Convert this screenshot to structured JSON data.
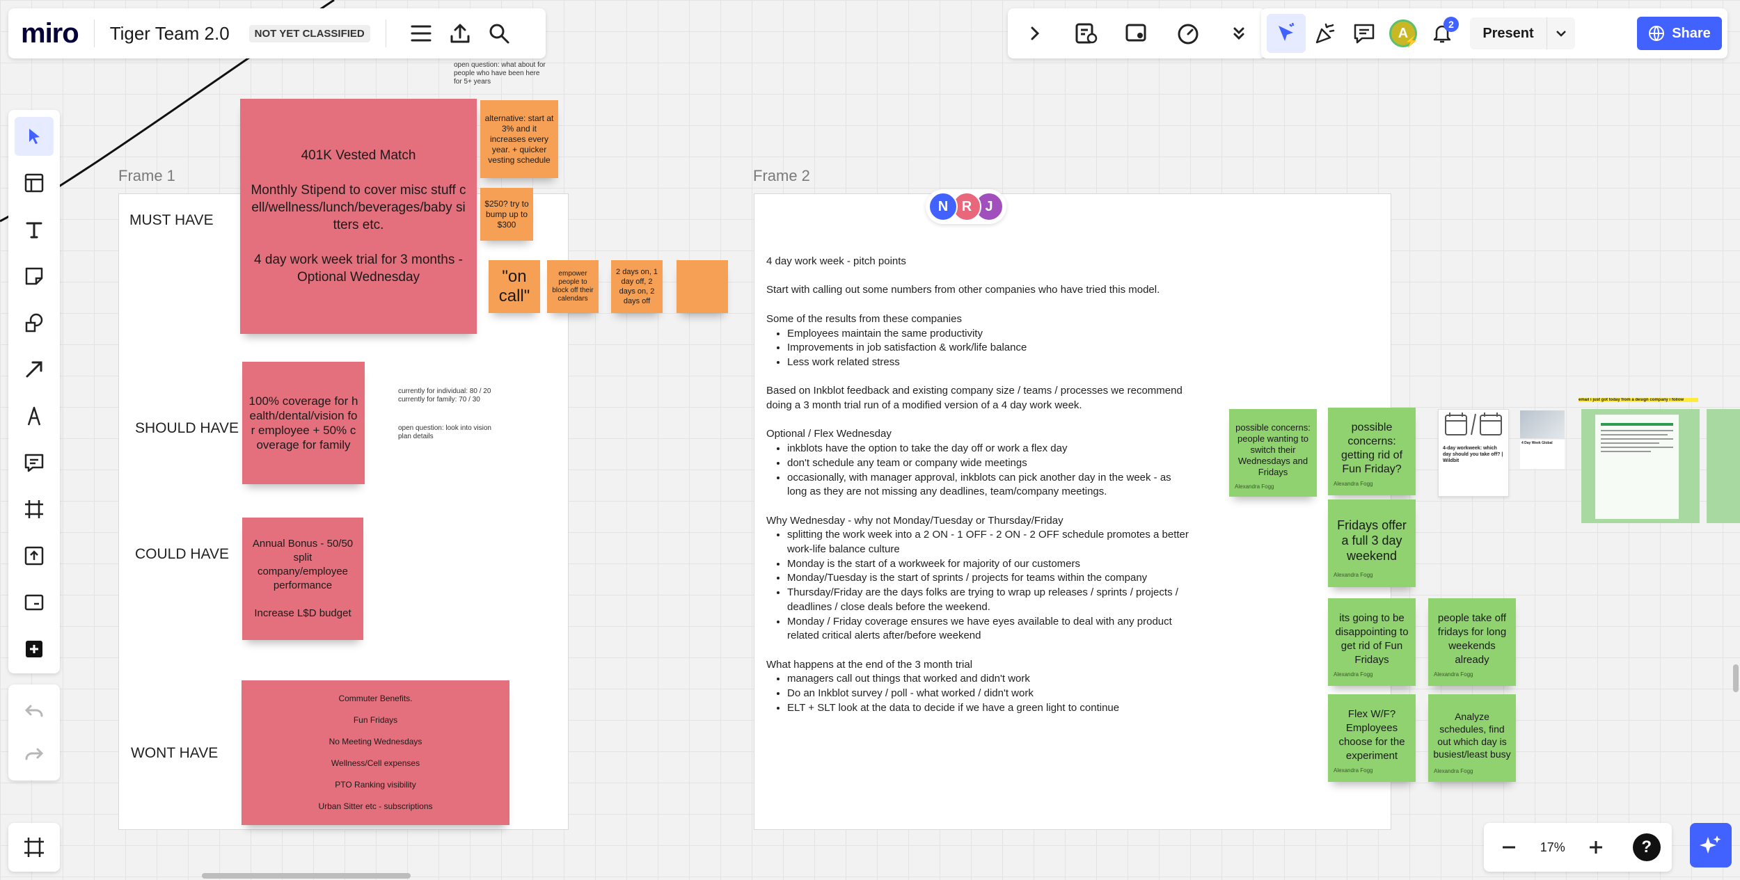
{
  "topbar": {
    "logo": "miro",
    "board_title": "Tiger Team 2.0",
    "classification": "NOT YET CLASSIFIED"
  },
  "top_right": {
    "avatar_initial": "A",
    "notification_count": "2",
    "present_label": "Present",
    "share_label": "Share"
  },
  "colors": {
    "accent": "#4262ff",
    "sticky_pink": "#e5707d",
    "sticky_orange": "#f6a055",
    "sticky_green": "#8fd26f"
  },
  "frame1": {
    "label": "Frame 1",
    "sections": {
      "must": "MUST HAVE",
      "should": "SHOULD HAVE",
      "could": "COULD HAVE",
      "wont": "WONT HAVE"
    },
    "must_sticky": [
      "401K Vested Match",
      "Monthly Stipend to cover misc stuff cell/wellness/lunch/beverages/baby sitters etc.",
      "4 day work week trial for 3 months - Optional Wednesday"
    ],
    "should_sticky": "100% coverage for health/dental/vision for employee + 50% coverage for family",
    "should_notes": {
      "individual": "currently for individual: 80 / 20",
      "family": "currently for family: 70 / 30",
      "question": "open question: look into vision plan details"
    },
    "could_sticky": [
      "Annual Bonus - 50/50 split company/employee performance",
      "Increase L$D budget"
    ],
    "wont_sticky": [
      "Commuter Benefits.",
      "Fun Fridays",
      "No Meeting Wednesdays",
      "Wellness/Cell expenses",
      "PTO Ranking visibility",
      "Urban Sitter etc - subscriptions"
    ],
    "top_note": "open question: what about for people who have been here for 5+ years",
    "orange_stickies": {
      "alternative": "alternative: start at 3% and it increases every year. + quicker vesting schedule",
      "bump": "$250? try to bump up to $300",
      "on_call": "\"on call\"",
      "empower": "empower people to block off their calendars",
      "days": "2 days on, 1 day off, 2 days on, 2 days off",
      "blank": ""
    }
  },
  "frame2": {
    "label": "Frame 2",
    "collaborators": [
      "N",
      "R",
      "J"
    ],
    "doc": {
      "title": "4 day work week - pitch points",
      "intro": "Start with calling out some numbers from other companies who have tried this model.",
      "results_heading": "Some of the results from these companies",
      "results": [
        "Employees maintain the same productivity",
        "Improvements in job satisfaction & work/life balance",
        "Less work related stress"
      ],
      "recommendation": "Based on Inkblot feedback and existing company size / teams / processes we recommend doing a 3 month trial run of a modified version of a 4 day work week.",
      "optional_heading": "Optional / Flex Wednesday",
      "optional": [
        "inkblots have the option to take the day off or work a flex day",
        "don't schedule any team or company wide meetings",
        "occasionally, with manager approval, inkblots can pick another day in the week - as long as they are not missing any deadlines, team/company meetings."
      ],
      "why_heading": "Why Wednesday - why not Monday/Tuesday or Thursday/Friday",
      "why": [
        "splitting the work week into a 2 ON - 1 OFF - 2 ON - 2 OFF schedule promotes a better work-life balance culture",
        "Monday is the start of a workweek for majority of our customers",
        "Monday/Tuesday is the start of sprints / projects for teams within the company",
        "Thursday/Friday are the days folks are trying to wrap up releases / sprints / projects / deadlines / close deals before the weekend.",
        "Monday / Friday coverage ensures we have eyes available to deal with any product related critical alerts after/before weekend"
      ],
      "end_heading": "What happens at the end of the 3 month trial",
      "end": [
        "managers call out things that worked and didn't work",
        "Do an Inkblot survey / poll - what worked / didn't work",
        "ELT + SLT look at the data to decide if we have a green light to continue"
      ]
    }
  },
  "green_stickies": {
    "concern1": "possible concerns: people wanting to switch their Wednesdays and Fridays",
    "concern2": "possible concerns: getting rid of Fun Friday?",
    "full_weekend": "Fridays offer a full 3 day weekend",
    "disappointing": "its going to be disappointing to get rid of Fun Fridays",
    "long_weekends": "people take off fridays for long weekends already",
    "flex": "Flex W/F? Employees choose for the experiment",
    "analyze": "Analyze schedules, find out which day is busiest/least busy",
    "author": "Alexandra Fogg"
  },
  "clippings": {
    "headline": "4-day workweek: which day should you take off? | Wildbit",
    "title_small": "4 Day Week Global",
    "email_banner": "email i just got today from a design company i follow"
  },
  "zoom": {
    "level": "17%"
  }
}
